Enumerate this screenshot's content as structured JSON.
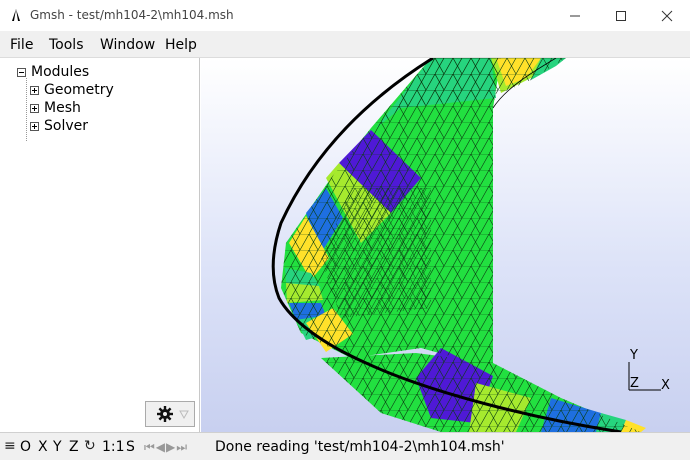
{
  "window": {
    "title": "Gmsh - test/mh104-2\\mh104.msh"
  },
  "menu": {
    "file": "File",
    "tools": "Tools",
    "window": "Window",
    "help": "Help"
  },
  "tree": {
    "root": "Modules",
    "items": [
      "Geometry",
      "Mesh",
      "Solver"
    ]
  },
  "statusbar": {
    "o": "O",
    "x": "X",
    "y": "Y",
    "z": "Z",
    "scale": "1:1",
    "s": "S",
    "message": "Done reading 'test/mh104-2\\mh104.msh'"
  },
  "axes": {
    "y": "Y",
    "z": "Z",
    "x": "X"
  },
  "colors": {
    "green": "#22e040",
    "teal": "#26d47e",
    "blue": "#1e6fe0",
    "violet": "#4f19d6",
    "yellow": "#ffe12a",
    "lime": "#a6ea2e"
  }
}
